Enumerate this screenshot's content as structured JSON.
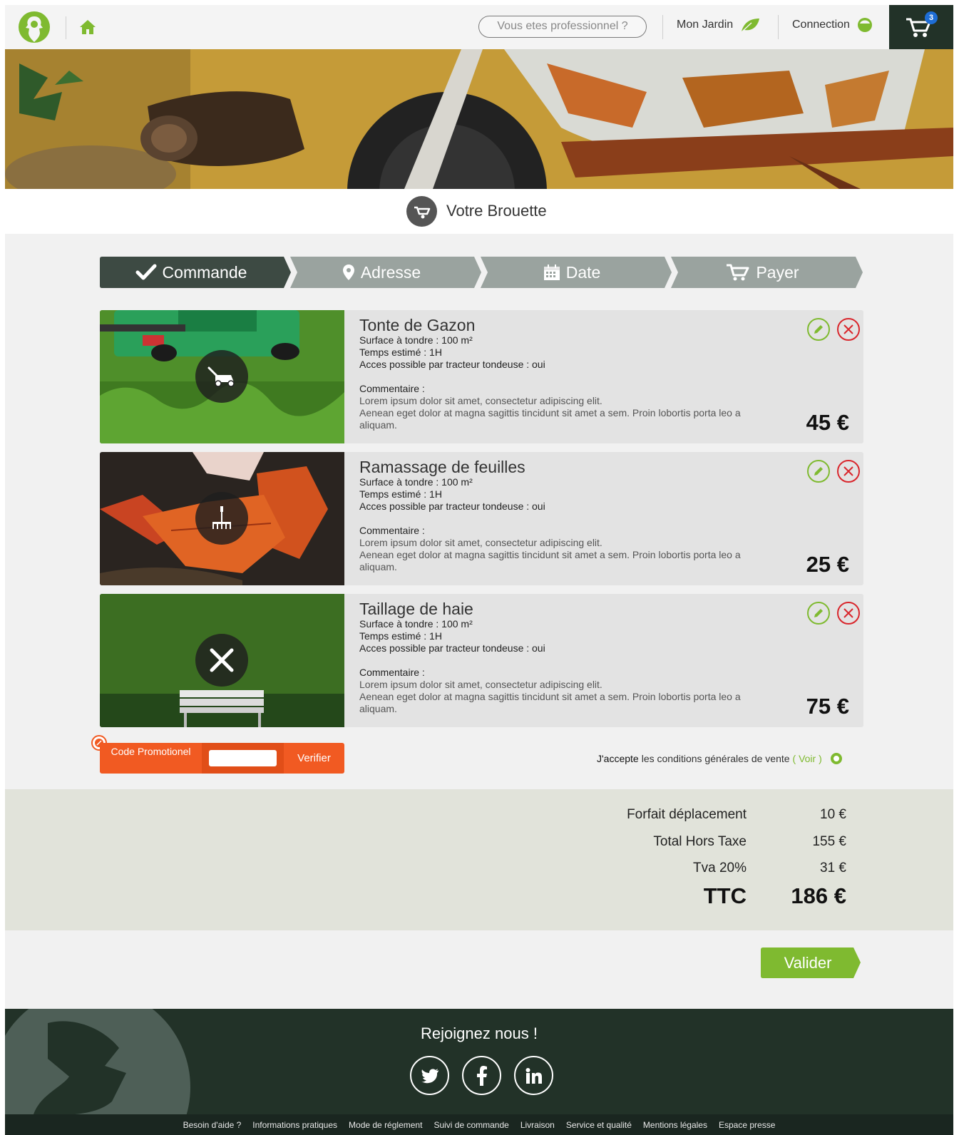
{
  "header": {
    "pro_label": "Vous etes professionnel ?",
    "garden_label": "Mon Jardin",
    "connection_label": "Connection",
    "cart_count": "3"
  },
  "page": {
    "title": "Votre Brouette"
  },
  "steps": [
    {
      "label": "Commande",
      "icon": "check-icon",
      "active": true
    },
    {
      "label": "Adresse",
      "icon": "map-pin-icon",
      "active": false
    },
    {
      "label": "Date",
      "icon": "calendar-icon",
      "active": false
    },
    {
      "label": "Payer",
      "icon": "cart-icon",
      "active": false
    }
  ],
  "items": [
    {
      "name": "Tonte de Gazon",
      "surface": "Surface à tondre : 100 m²",
      "duration": "Temps estimé : 1H",
      "access": "Acces possible par tracteur tondeuse : oui",
      "comment_label": "Commentaire :",
      "comment_line1": "Lorem ipsum dolor sit amet, consectetur adipiscing elit.",
      "comment_line2": "Aenean eget dolor at magna sagittis tincidunt sit amet a sem. Proin lobortis porta leo a aliquam.",
      "price": "45 €",
      "icon": "lawnmower-icon"
    },
    {
      "name": "Ramassage de feuilles",
      "surface": "Surface à tondre : 100 m²",
      "duration": "Temps estimé : 1H",
      "access": "Acces possible par tracteur tondeuse : oui",
      "comment_label": "Commentaire :",
      "comment_line1": "Lorem ipsum dolor sit amet, consectetur adipiscing elit.",
      "comment_line2": "Aenean eget dolor at magna sagittis tincidunt sit amet a sem. Proin lobortis porta leo a aliquam.",
      "price": "25 €",
      "icon": "rake-icon"
    },
    {
      "name": "Taillage de haie",
      "surface": "Surface à tondre : 100 m²",
      "duration": "Temps estimé : 1H",
      "access": "Acces possible par tracteur tondeuse : oui",
      "comment_label": "Commentaire :",
      "comment_line1": "Lorem ipsum dolor sit amet, consectetur adipiscing elit.",
      "comment_line2": "Aenean eget dolor at magna sagittis tincidunt sit amet a sem. Proin lobortis porta leo a aliquam.",
      "price": "75 €",
      "icon": "hedge-shears-icon"
    }
  ],
  "promo": {
    "label": "Code Promotionel",
    "input_value": "",
    "button_label": "Verifier"
  },
  "cgv": {
    "accept": "J'accepte",
    "text": "les conditions générales de vente",
    "link": "( Voir )"
  },
  "totals": {
    "travel_label": "Forfait déplacement",
    "travel_value": "10 €",
    "ht_label": "Total Hors Taxe",
    "ht_value": "155 €",
    "tva_label": "Tva 20%",
    "tva_value": "31 €",
    "ttc_label": "TTC",
    "ttc_value": "186 €"
  },
  "validate_label": "Valider",
  "footer": {
    "join_label": "Rejoignez nous !",
    "social": [
      "twitter-icon",
      "facebook-icon",
      "linkedin-icon"
    ],
    "links": [
      "Besoin d'aide ?",
      "Informations pratiques",
      "Mode de réglement",
      "Suivi de commande",
      "Livraison",
      "Service et qualité",
      "Mentions légales",
      "Espace presse"
    ]
  },
  "colors": {
    "dark_green": "#223228",
    "accent_green": "#7fba30",
    "orange": "#f15a22",
    "step_grey": "#9aa39f",
    "delete_red": "#d9262c"
  }
}
